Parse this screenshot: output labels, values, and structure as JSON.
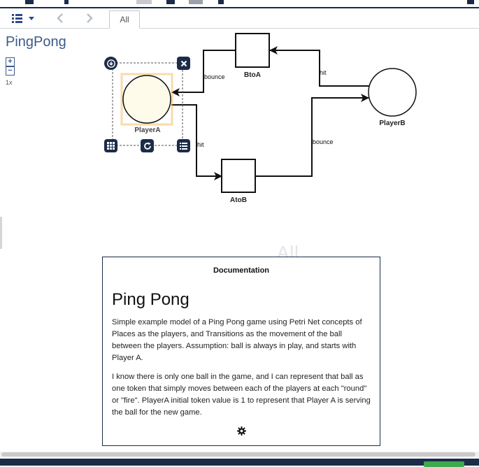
{
  "toolbar": {
    "tab_label": "All"
  },
  "diagram": {
    "title": "PingPong",
    "zoom_in": "+",
    "zoom_out": "−",
    "zoom_level": "1x",
    "watermark": "All",
    "places": [
      {
        "id": "PlayerA",
        "label": "PlayerA",
        "selected": true
      },
      {
        "id": "PlayerB",
        "label": "PlayerB",
        "selected": false
      }
    ],
    "transitions": [
      {
        "id": "BtoA",
        "label": "BtoA"
      },
      {
        "id": "AtoB",
        "label": "AtoB"
      }
    ],
    "arcs": [
      {
        "from": "PlayerA",
        "to": "AtoB",
        "label": "hit"
      },
      {
        "from": "AtoB",
        "to": "PlayerB",
        "label": "bounce"
      },
      {
        "from": "PlayerB",
        "to": "BtoA",
        "label": "hit"
      },
      {
        "from": "BtoA",
        "to": "PlayerA",
        "label": "bounce"
      }
    ],
    "selection_controls": [
      "download-icon",
      "close-icon",
      "grid-icon",
      "refresh-icon",
      "list-icon"
    ]
  },
  "documentation": {
    "header": "Documentation",
    "title": "Ping Pong",
    "paragraph1": "Simple example model of a Ping Pong game using Petri Net concepts of Places as the players, and Transitions as the movement of the ball between the players. Assumption: ball is always in play, and starts with Player A.",
    "paragraph2": "I know there is only one ball in the game, and I can represent that ball as one token that simply moves between each of the players at each \"round\" or \"fire\". PlayerA initial token value is 1 to represent that Player A is serving the ball for the new game.",
    "settings_icon": "gear-icon"
  },
  "colors": {
    "navy": "#1b2c4a",
    "title_blue": "#3e5a8a",
    "selection_fill": "#fffbea",
    "selection_glow": "#f5b041",
    "status_green": "#3caa4d"
  }
}
